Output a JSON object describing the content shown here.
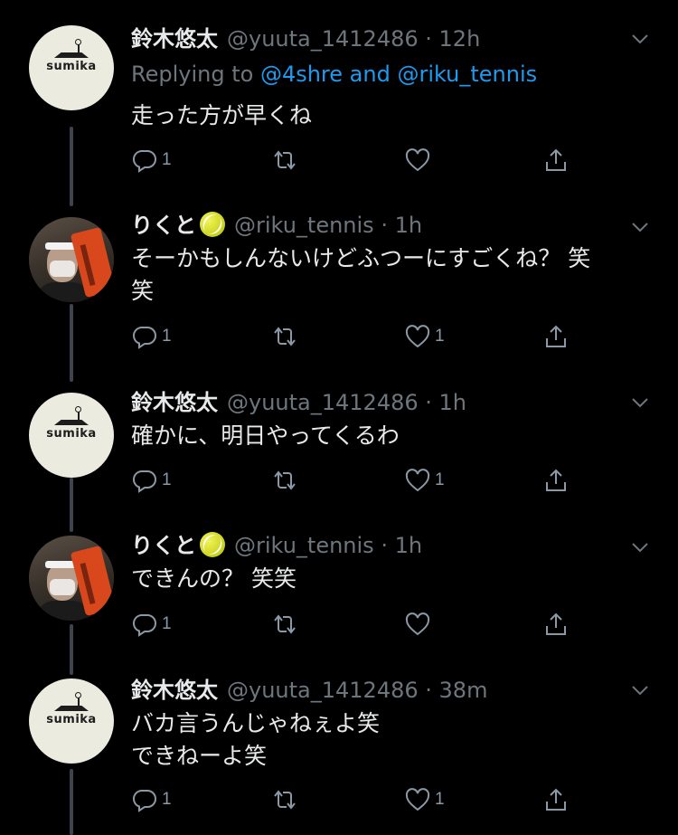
{
  "tweets": [
    {
      "name": "鈴木悠太",
      "handle": "@yuuta_1412486",
      "time": "12h",
      "avatar": "sumika",
      "avatar_text": "sumika",
      "replying_label": "Replying to ",
      "replying_users": [
        "@4shre",
        "@riku_tennis"
      ],
      "replying_join": " and ",
      "lines": [
        "走った方が早くね"
      ],
      "replies": "1",
      "retweets": "",
      "likes": ""
    },
    {
      "name": "りくと",
      "handle": "@riku_tennis",
      "time": "1h",
      "avatar": "photo",
      "emoji": "tennis-ball",
      "lines": [
        "そーかもしんないけどふつーにすごくね？ 笑",
        "笑"
      ],
      "replies": "1",
      "retweets": "",
      "likes": "1"
    },
    {
      "name": "鈴木悠太",
      "handle": "@yuuta_1412486",
      "time": "1h",
      "avatar": "sumika",
      "avatar_text": "sumika",
      "lines": [
        "確かに、明日やってくるわ"
      ],
      "replies": "1",
      "retweets": "",
      "likes": "1"
    },
    {
      "name": "りくと",
      "handle": "@riku_tennis",
      "time": "1h",
      "avatar": "photo",
      "emoji": "tennis-ball",
      "lines": [
        "できんの？ 笑笑"
      ],
      "replies": "1",
      "retweets": "",
      "likes": ""
    },
    {
      "name": "鈴木悠太",
      "handle": "@yuuta_1412486",
      "time": "38m",
      "avatar": "sumika",
      "avatar_text": "sumika",
      "lines": [
        "バカ言うんじゃねぇよ笑",
        "できねーよ笑"
      ],
      "replies": "1",
      "retweets": "",
      "likes": "1"
    }
  ],
  "separator": " · ",
  "icons": {
    "reply": "reply-icon",
    "retweet": "retweet-icon",
    "like": "heart-icon",
    "share": "share-icon",
    "menu": "chevron-down-icon"
  },
  "colors": {
    "background": "#000000",
    "link": "#1d9bf0",
    "muted": "#6e767d",
    "text": "#e7e9ea",
    "thread_line": "#3d4450"
  }
}
